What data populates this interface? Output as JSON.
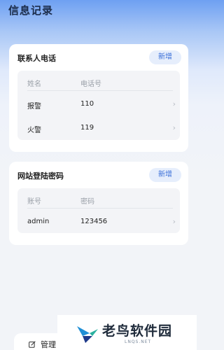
{
  "page": {
    "title": "信息记录"
  },
  "contacts": {
    "title": "联系人电话",
    "add_label": "新增",
    "columns": [
      "姓名",
      "电话号"
    ],
    "rows": [
      {
        "name": "报警",
        "phone": "110"
      },
      {
        "name": "火警",
        "phone": "119"
      }
    ]
  },
  "passwords": {
    "title": "网站登陆密码",
    "add_label": "新增",
    "columns": [
      "账号",
      "密码"
    ],
    "rows": [
      {
        "account": "admin",
        "password": "123456"
      }
    ]
  },
  "bottom_nav": {
    "manage_label": "管理",
    "manage_icon": "edit-icon"
  },
  "watermark": {
    "text": "老鸟软件园",
    "sub": "LNQS.NET"
  },
  "colors": {
    "accent": "#3a6fd8",
    "add_bg": "#e6eefc"
  }
}
